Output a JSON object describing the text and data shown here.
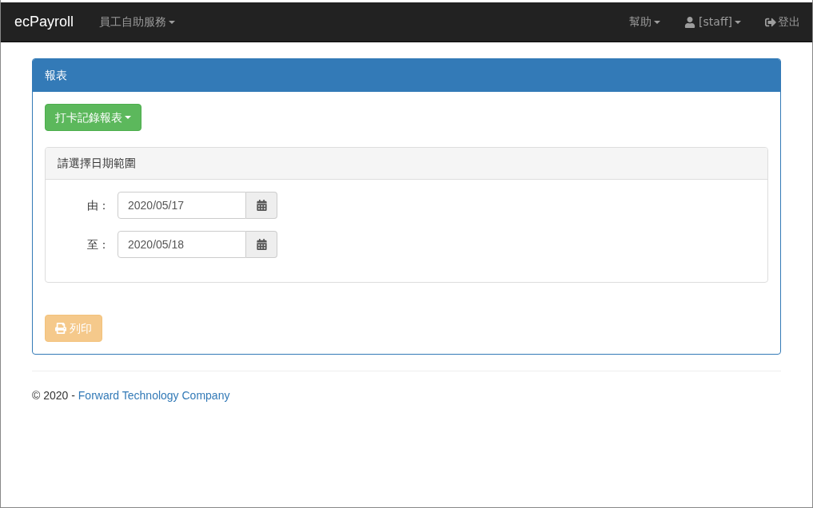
{
  "navbar": {
    "brand": "ecPayroll",
    "menus": [
      {
        "label": "員工自助服務",
        "kind": "dropdown"
      }
    ],
    "right": [
      {
        "label": "幫助",
        "kind": "dropdown"
      },
      {
        "label": "[staff]",
        "kind": "user"
      },
      {
        "label": "登出",
        "kind": "logout"
      }
    ]
  },
  "panel": {
    "title": "報表",
    "report_menu": "打卡記錄報表",
    "date_range": {
      "title": "請選擇日期範圍",
      "fields": [
        {
          "label": "由：",
          "value": "2020/05/17"
        },
        {
          "label": "至：",
          "value": "2020/05/18"
        }
      ]
    },
    "print_button": {
      "label": "列印",
      "disabled": true
    }
  },
  "footer": {
    "text": "© 2020 - ",
    "link": "Forward Technology Company"
  }
}
